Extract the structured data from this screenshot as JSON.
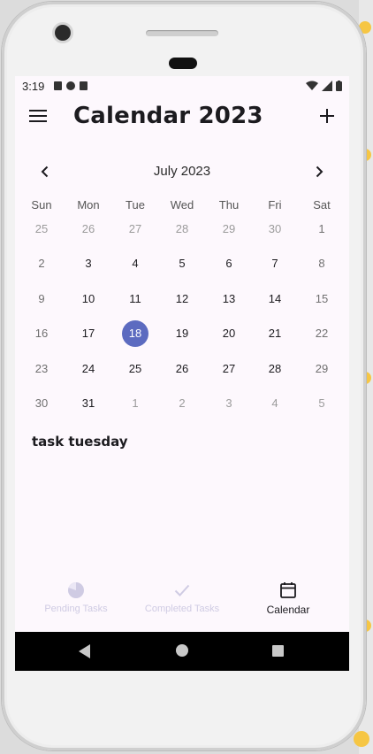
{
  "status_bar": {
    "time": "3:19",
    "icons": [
      "a-icon",
      "badge-icon",
      "sim-icon",
      "wifi-icon",
      "signal-icon",
      "battery-icon"
    ]
  },
  "app_bar": {
    "title": "Calendar 2023",
    "menu_icon": "menu-icon",
    "add_icon": "add-icon"
  },
  "calendar": {
    "month_label": "July 2023",
    "weekdays": [
      "Sun",
      "Mon",
      "Tue",
      "Wed",
      "Thu",
      "Fri",
      "Sat"
    ],
    "weeks": [
      [
        "25",
        "26",
        "27",
        "28",
        "29",
        "30",
        "1"
      ],
      [
        "2",
        "3",
        "4",
        "5",
        "6",
        "7",
        "8"
      ],
      [
        "9",
        "10",
        "11",
        "12",
        "13",
        "14",
        "15"
      ],
      [
        "16",
        "17",
        "18",
        "19",
        "20",
        "21",
        "22"
      ],
      [
        "23",
        "24",
        "25",
        "26",
        "27",
        "28",
        "29"
      ],
      [
        "30",
        "31",
        "1",
        "2",
        "3",
        "4",
        "5"
      ]
    ],
    "selected_day": "18",
    "accent_color": "#5c6bc0"
  },
  "task": {
    "title": "task tuesday"
  },
  "bottom_nav": {
    "items": [
      {
        "label": "Pending Tasks",
        "icon": "pie-chart-icon",
        "active": false
      },
      {
        "label": "Completed Tasks",
        "icon": "check-icon",
        "active": false
      },
      {
        "label": "Calendar",
        "icon": "calendar-icon",
        "active": true
      }
    ]
  }
}
